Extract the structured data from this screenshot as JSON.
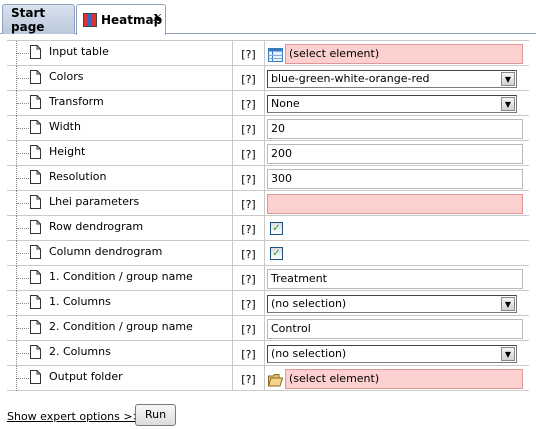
{
  "tabs": [
    {
      "label": "Start page"
    },
    {
      "label": "Heatmap",
      "close": "x"
    }
  ],
  "help_label": "[?]",
  "params": [
    {
      "label": "Input table",
      "type": "element",
      "value": "(select element)",
      "icon": "table-icon"
    },
    {
      "label": "Colors",
      "type": "select",
      "value": "blue-green-white-orange-red"
    },
    {
      "label": "Transform",
      "type": "select",
      "value": "None"
    },
    {
      "label": "Width",
      "type": "text",
      "value": "20"
    },
    {
      "label": "Height",
      "type": "text",
      "value": "200"
    },
    {
      "label": "Resolution",
      "type": "text",
      "value": "300"
    },
    {
      "label": "Lhei parameters",
      "type": "pink",
      "value": ""
    },
    {
      "label": "Row dendrogram",
      "type": "checkbox",
      "checked": true
    },
    {
      "label": "Column dendrogram",
      "type": "checkbox",
      "checked": true
    },
    {
      "label": "1. Condition / group name",
      "type": "text",
      "value": "Treatment"
    },
    {
      "label": "1. Columns",
      "type": "select",
      "value": "(no selection)"
    },
    {
      "label": "2. Condition / group name",
      "type": "text",
      "value": "Control"
    },
    {
      "label": "2. Columns",
      "type": "select",
      "value": "(no selection)"
    },
    {
      "label": "Output folder",
      "type": "element",
      "value": "(select element)",
      "icon": "folder-icon"
    }
  ],
  "footer": {
    "expert_link": "Show expert options >>",
    "run_label": "Run"
  },
  "colors": {
    "invalid_bg": "#fdd0d0",
    "tab_bg": "#c9d5e5"
  }
}
